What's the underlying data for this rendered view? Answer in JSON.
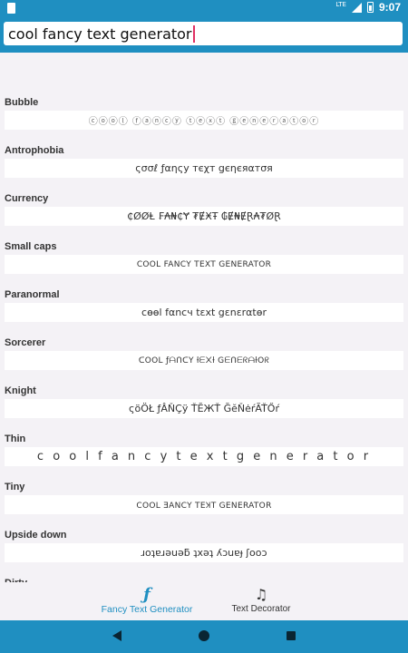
{
  "status_bar": {
    "network": "LTE",
    "time": "9:07"
  },
  "search": {
    "value": "cool fancy text generator"
  },
  "styles": [
    {
      "label": "Bubble",
      "text": "ⓒⓞⓞⓛ ⓕⓐⓝⓒⓨ ⓣⓔⓧⓣ ⓖⓔⓝⓔⓡⓐⓣⓞⓡ",
      "variant": "bubble"
    },
    {
      "label": "Antrophobia",
      "text": "ςσσℓ ƒαηςу тєχт gєηєяαтσя",
      "variant": ""
    },
    {
      "label": "Currency",
      "text": "₵ØØⱠ ₣₳₦₵Ɏ ₮ɆӾŦ ₲Ɇ₦ɆⱤ₳₮ØⱤ",
      "variant": ""
    },
    {
      "label": "Small caps",
      "text": "COOL FANCY TEXT GENERATOR",
      "variant": "smallcaps"
    },
    {
      "label": "Paranormal",
      "text": "cѳѳl fαncч tεxt gεnεrαtѳr",
      "variant": ""
    },
    {
      "label": "Sorcerer",
      "text": "ᑕOOᒪ ƒᗩᑎᑕY ƚᗴ᙭ƚ GᗴᑎᗴᖇᗩƚOᖇ",
      "variant": "smallcaps"
    },
    {
      "label": "Knight",
      "text": "ςöÖŁ ƒÂŇÇÿ ŤĔЖŤ ĞĕŇėŕÃŤŐŕ",
      "variant": ""
    },
    {
      "label": "Thin",
      "text": "c o o l  f a n c y  t e x t  g e n e r a t o r",
      "variant": "thin"
    },
    {
      "label": "Tiny",
      "text": "COOL ƎANCY TEꞰT GENERATOR",
      "variant": "smallcaps"
    },
    {
      "label": "Upside down",
      "text": "ɹoʇɐɹǝuǝƃ ʇxǝʇ ʎɔuɐɟ ʃooɔ",
      "variant": ""
    },
    {
      "label": "Dirty",
      "text": "",
      "variant": ""
    }
  ],
  "bottom_nav": {
    "tab1_label": "Fancy Text Generator",
    "tab1_icon": "ƒ",
    "tab2_label": "Text Decorator",
    "tab2_icon": "♫"
  },
  "colors": {
    "primary": "#1f8fc1",
    "background": "#f4f2f6",
    "caret": "#e03063"
  }
}
